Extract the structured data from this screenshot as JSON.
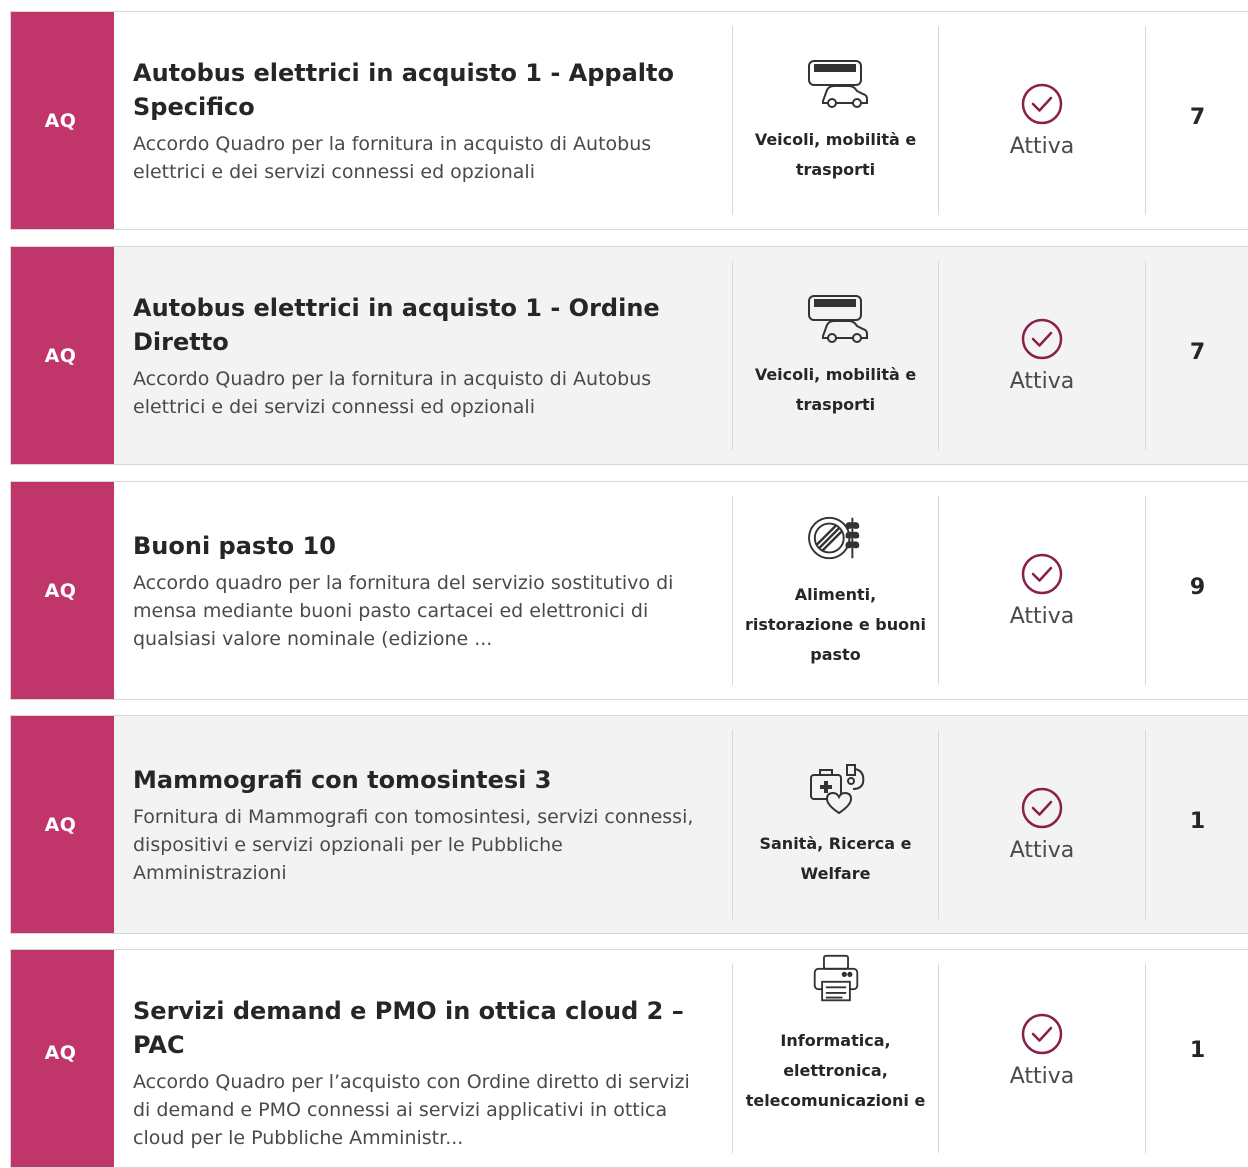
{
  "colors": {
    "badge": "#c0356a",
    "status_icon": "#8a1f4d",
    "alt_row": "#f3f3f3"
  },
  "rows": [
    {
      "badge": "AQ",
      "title": "Autobus elettrici in acquisto 1 - Appalto Specifico",
      "description": "Accordo Quadro per la fornitura in acquisto di Autobus elettrici e dei servizi connessi ed opzionali",
      "category_icon": "bus-car-icon",
      "category": "Veicoli, mobilità e trasporti",
      "status": "Attiva",
      "count": "7"
    },
    {
      "badge": "AQ",
      "title": "Autobus elettrici in acquisto 1 - Ordine Diretto",
      "description": "Accordo Quadro per la fornitura in acquisto di Autobus elettrici e dei servizi connessi ed opzionali",
      "category_icon": "bus-car-icon",
      "category": "Veicoli, mobilità e trasporti",
      "status": "Attiva",
      "count": "7"
    },
    {
      "badge": "AQ",
      "title": "Buoni pasto 10",
      "description": "Accordo quadro per la fornitura del servizio sostitutivo di mensa mediante buoni pasto cartacei ed elettronici di qualsiasi valore nominale (edizione ...",
      "category_icon": "food-wheat-icon",
      "category": "Alimenti, ristorazione e buoni pasto",
      "status": "Attiva",
      "count": "9"
    },
    {
      "badge": "AQ",
      "title": "Mammografi con tomosintesi 3",
      "description": "Fornitura di Mammografi con tomosintesi, servizi connessi, dispositivi e servizi opzionali per le Pubbliche Amministrazioni",
      "category_icon": "medical-kit-heart-icon",
      "category": "Sanità, Ricerca e Welfare",
      "status": "Attiva",
      "count": "1"
    },
    {
      "badge": "AQ",
      "title": "Servizi demand e PMO in ottica cloud 2 – PAC",
      "description": "Accordo Quadro per l’acquisto con Ordine diretto di servizi di demand e PMO connessi ai servizi applicativi in ottica cloud per le Pubbliche Amministr...",
      "category_icon": "printer-icon",
      "category": "Informatica, elettronica, telecomunicazioni e",
      "status": "Attiva",
      "count": "1"
    }
  ]
}
